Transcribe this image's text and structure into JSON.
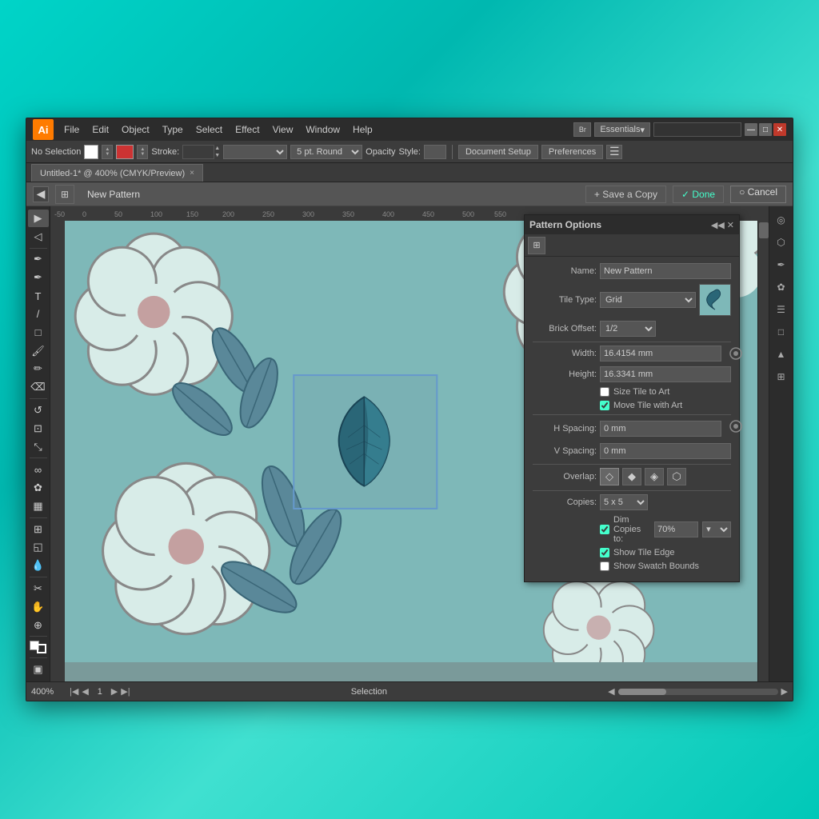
{
  "titlebar": {
    "ai_logo": "Ai",
    "menu_items": [
      "File",
      "Edit",
      "Object",
      "Type",
      "Select",
      "Effect",
      "View",
      "Window",
      "Help"
    ],
    "workspace_label": "Essentials",
    "search_placeholder": "",
    "wm_min": "—",
    "wm_max": "□",
    "wm_close": "✕"
  },
  "toolbar2": {
    "no_selection": "No Selection",
    "stroke_label": "Stroke:",
    "stroke_value": "",
    "pt_label": "5 pt. Round",
    "opacity_label": "Opacity",
    "style_label": "Style:",
    "doc_setup": "Document Setup",
    "preferences": "Preferences"
  },
  "tab": {
    "title": "Untitled-1* @ 400% (CMYK/Preview)",
    "close": "×"
  },
  "pattern_bar": {
    "new_pattern": "New Pattern",
    "save_copy": "+ Save a Copy",
    "done_check": "✓ Done",
    "cancel_circle": "○ Cancel"
  },
  "pattern_options": {
    "title": "Pattern Options",
    "name_label": "Name:",
    "name_value": "New Pattern",
    "tile_type_label": "Tile Type:",
    "tile_type_value": "Grid",
    "brick_offset_label": "Brick Offset:",
    "brick_offset_value": "1/2",
    "width_label": "Width:",
    "width_value": "16.4154 mm",
    "height_label": "Height:",
    "height_value": "16.3341 mm",
    "size_tile_label": "Size Tile to Art",
    "move_tile_label": "Move Tile with Art",
    "h_spacing_label": "H Spacing:",
    "h_spacing_value": "0 mm",
    "v_spacing_label": "V Spacing:",
    "v_spacing_value": "0 mm",
    "overlap_label": "Overlap:",
    "copies_label": "Copies:",
    "copies_value": "5 x 5",
    "dim_copies_label": "Dim Copies to:",
    "dim_value": "70%",
    "show_tile_label": "Show Tile Edge",
    "show_swatch_label": "Show Swatch Bounds"
  },
  "bottom_bar": {
    "zoom": "400%",
    "page": "1",
    "status": "Selection"
  },
  "tools": [
    "▶",
    "◀",
    "✚",
    "✎",
    "T",
    "╲",
    "□",
    "✏",
    "○",
    "✂",
    "⌫",
    "⊕",
    "✿",
    "⟳",
    "⬡",
    "⊞",
    "◈"
  ],
  "right_panel": [
    "◎",
    "☰",
    "□",
    "▲",
    "◆"
  ]
}
